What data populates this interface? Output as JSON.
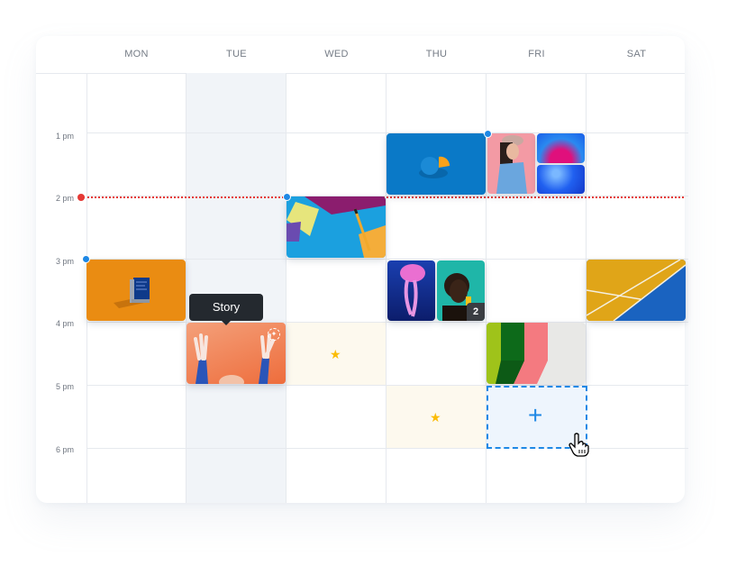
{
  "calendar": {
    "days": [
      "MON",
      "TUE",
      "WED",
      "THU",
      "FRI",
      "SAT"
    ],
    "time_labels": [
      "1 pm",
      "2 pm",
      "3 pm",
      "4 pm",
      "5 pm",
      "6 pm"
    ],
    "current_time_label": "2 pm",
    "highlight_day": "TUE",
    "colors": {
      "accent": "#1e88e5",
      "now_line": "#e53935",
      "highlight_column": "#f1f4f8",
      "star": "#fbbc05",
      "tooltip_bg": "#24292f"
    }
  },
  "tooltip": {
    "label": "Story"
  },
  "events": [
    {
      "day": "MON",
      "start": "3 pm",
      "kind": "image",
      "description": "Blue book on orange background"
    },
    {
      "day": "TUE",
      "start": "4 pm",
      "kind": "story",
      "description": "Hands raised on orange background"
    },
    {
      "day": "WED",
      "start": "2 pm",
      "kind": "image",
      "description": "Colorful paper and pencil"
    },
    {
      "day": "WED",
      "start": "4 pm",
      "kind": "favorite-slot"
    },
    {
      "day": "THU",
      "start": "1 pm",
      "kind": "image",
      "description": "Blue orange on blue background"
    },
    {
      "day": "THU",
      "start": "3 pm",
      "kind": "gallery",
      "description": "Pink jellyfish and portrait",
      "extra_count": "2"
    },
    {
      "day": "THU",
      "start": "5 pm",
      "kind": "favorite-slot"
    },
    {
      "day": "FRI",
      "start": "1 pm",
      "kind": "gallery",
      "description": "Woman in cap and blue abstract images"
    },
    {
      "day": "FRI",
      "start": "4 pm",
      "kind": "image",
      "description": "Colorful wall stripes"
    },
    {
      "day": "FRI",
      "start": "5 pm",
      "kind": "new-slot",
      "icon": "plus-icon"
    },
    {
      "day": "SAT",
      "start": "3 pm",
      "kind": "image",
      "description": "Yellow and blue court"
    }
  ]
}
